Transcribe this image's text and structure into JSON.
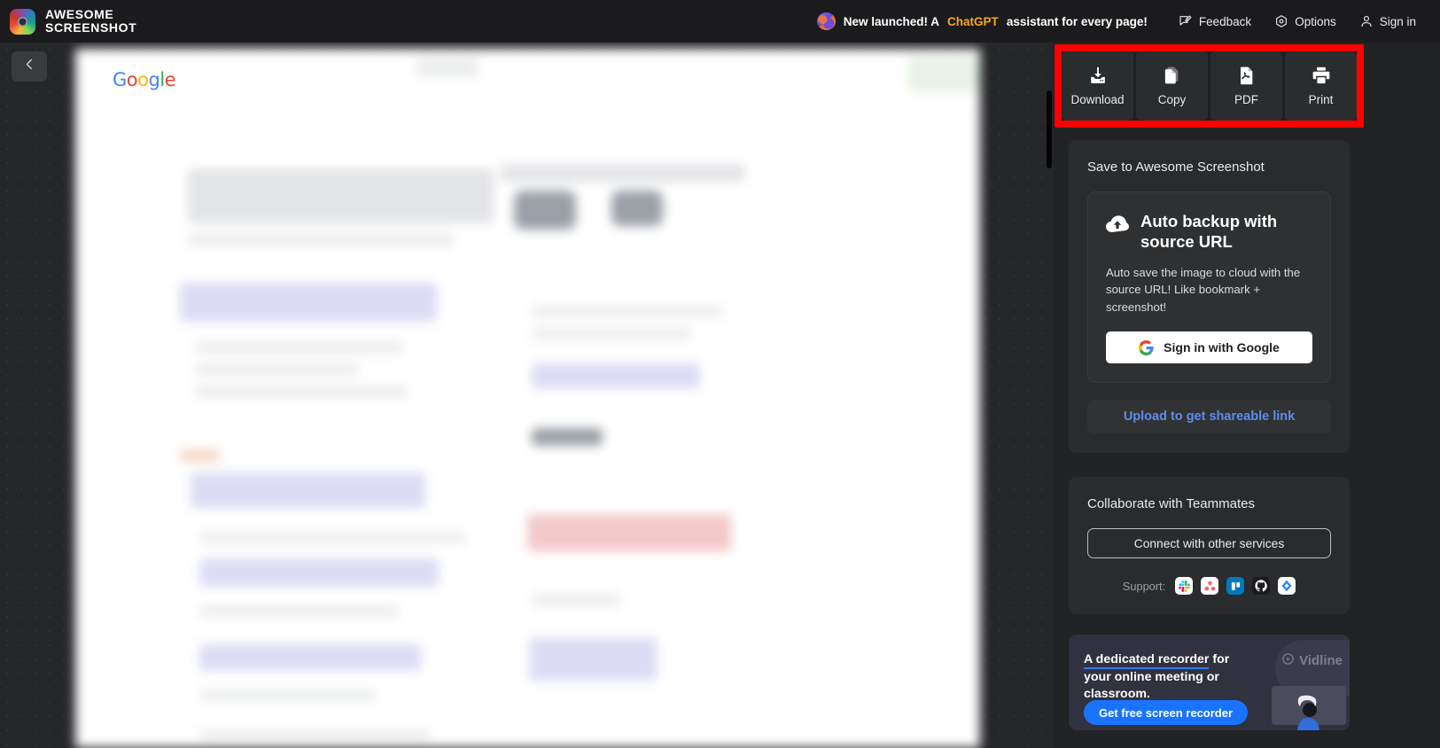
{
  "app": {
    "brand_line1": "AWESOME",
    "brand_line2": "SCREENSHOT",
    "logo_icon": "camera-logo-icon"
  },
  "header": {
    "promo_prefix": "New launched! A ",
    "promo_highlight": "ChatGPT",
    "promo_suffix": " assistant for every page!",
    "promo_icon": "brain-icon",
    "items": [
      {
        "label": "Feedback",
        "icon": "feedback-icon"
      },
      {
        "label": "Options",
        "icon": "gear-icon"
      },
      {
        "label": "Sign in",
        "icon": "user-icon"
      }
    ]
  },
  "workspace": {
    "collapse_icon": "chevron-left-icon",
    "canvas_logo": "Google",
    "canvas_logo_letters": [
      "G",
      "o",
      "o",
      "g",
      "l",
      "e"
    ]
  },
  "actions": {
    "highlight_color": "#ff0000",
    "buttons": [
      {
        "label": "Download",
        "icon": "download-icon"
      },
      {
        "label": "Copy",
        "icon": "copy-icon"
      },
      {
        "label": "PDF",
        "icon": "pdf-file-icon"
      },
      {
        "label": "Print",
        "icon": "printer-icon"
      }
    ]
  },
  "save_panel": {
    "title": "Save to Awesome Screenshot",
    "promo": {
      "icon": "cloud-upload-icon",
      "title": "Auto backup with source URL",
      "description": "Auto save the image to cloud with the source URL! Like bookmark + screenshot!",
      "google_button": "Sign in with Google",
      "google_icon": "google-g-icon"
    },
    "upload_link": "Upload to get shareable link",
    "upload_link_color": "#5b8dee"
  },
  "collaborate_panel": {
    "title": "Collaborate with Teammates",
    "connect_button": "Connect with other services",
    "support_label": "Support:",
    "services": [
      {
        "name": "slack-icon"
      },
      {
        "name": "asana-icon"
      },
      {
        "name": "trello-icon"
      },
      {
        "name": "github-icon"
      },
      {
        "name": "jira-icon"
      }
    ]
  },
  "promo_banner": {
    "close_label": "×",
    "text_highlight": "A dedicated recorder",
    "text_rest": " for your online meeting or classroom.",
    "cta": "Get free screen recorder",
    "cta_color": "#1a73ff",
    "brand": "Vidline",
    "brand_icon": "vidline-logo-icon"
  }
}
